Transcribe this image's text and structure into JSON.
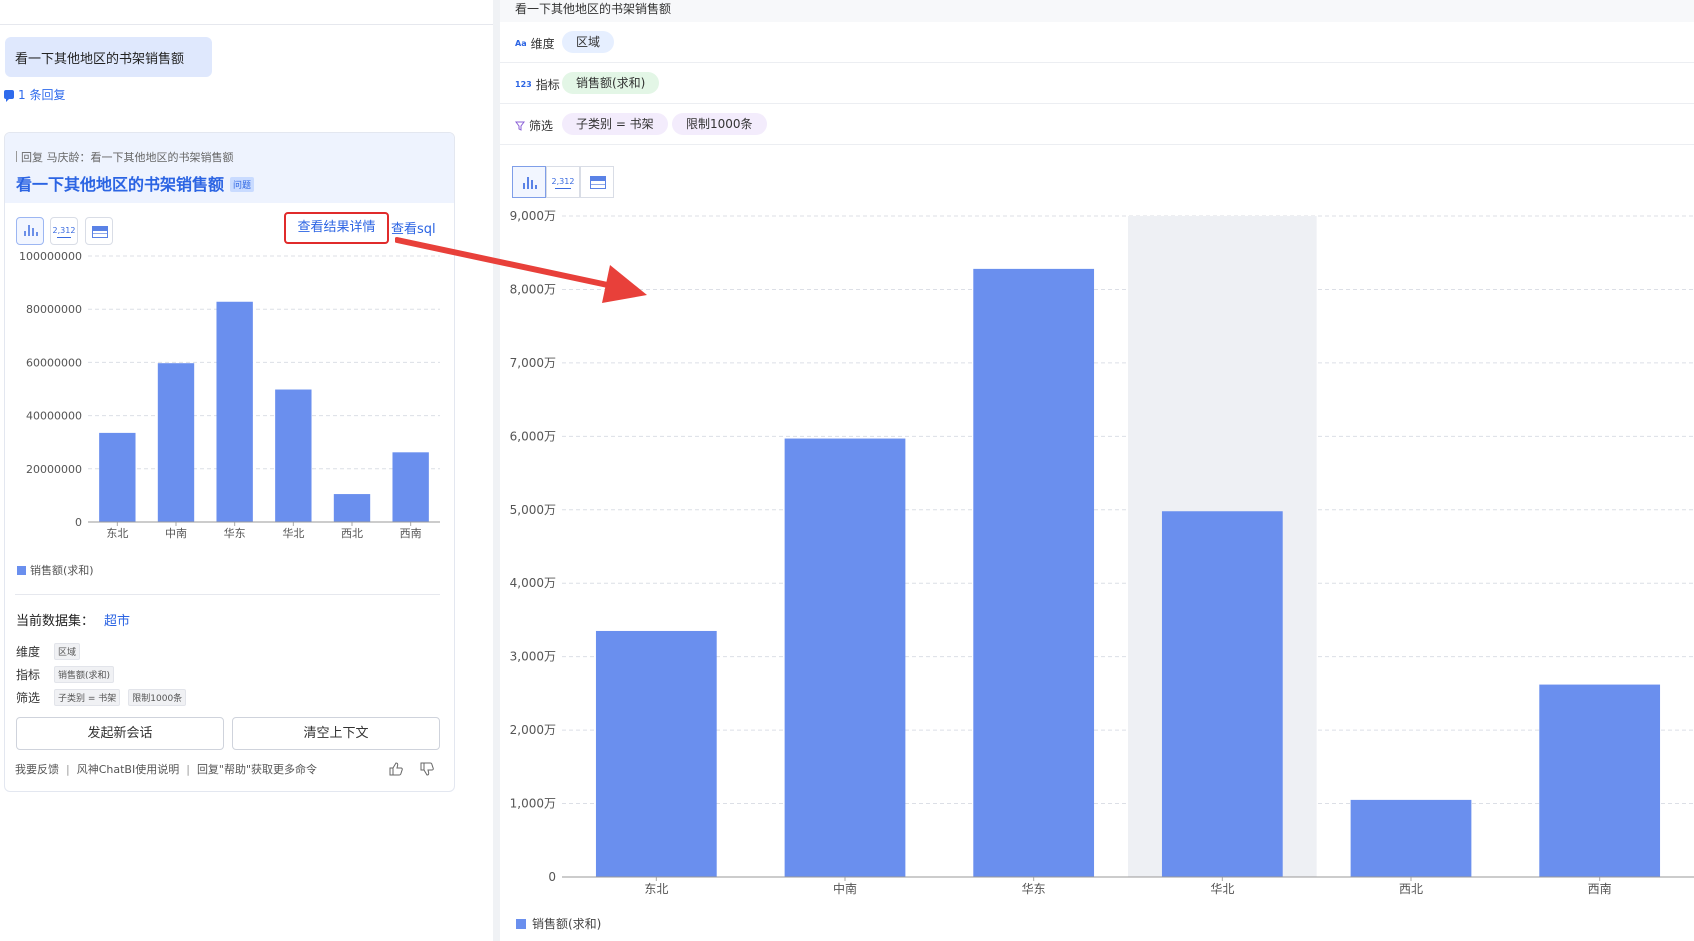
{
  "left": {
    "user_message": "看一下其他地区的书架销售额",
    "reply_count": "1 条回复",
    "card": {
      "reply_to": "回复 马庆龄：看一下其他地区的书架销售额",
      "question_title": "看一下其他地区的书架销售额",
      "question_badge": "问题",
      "view_buttons": [
        "bar-chart-icon",
        "number-card-icon",
        "table-icon"
      ],
      "view_detail_link": "查看结果详情",
      "view_sql_link": "查看sql",
      "dataset_label": "当前数据集：",
      "dataset_value": "超市",
      "dimension_label": "维度",
      "dimension_tags": [
        "区域"
      ],
      "metric_label": "指标",
      "metric_tags": [
        "销售额(求和)"
      ],
      "filter_label": "筛选",
      "filter_tags": [
        "子类别 = 书架",
        "限制1000条"
      ],
      "new_session_button": "发起新会话",
      "clear_context_button": "清空上下文",
      "footer_links": [
        "我要反馈",
        "风神ChatBI使用说明",
        "回复\"帮助\"获取更多命令"
      ]
    }
  },
  "right": {
    "title": "看一下其他地区的书架销售额",
    "dimension": {
      "label": "维度",
      "icon": "Aa",
      "tags": [
        "区域"
      ]
    },
    "metric": {
      "label": "指标",
      "icon": "123",
      "tags": [
        "销售额(求和)"
      ]
    },
    "filter": {
      "label": "筛选",
      "icon": "filter-icon",
      "tags": [
        "子类别 = 书架",
        "限制1000条"
      ]
    }
  },
  "colors": {
    "bar": "#6a8fee",
    "accent": "#2b64e3",
    "highlight_border": "#e02b2b",
    "arrow": "#e8403a"
  },
  "chart_data": [
    {
      "type": "bar",
      "categories": [
        "东北",
        "中南",
        "华东",
        "华北",
        "西北",
        "西南"
      ],
      "series": [
        {
          "name": "销售额(求和)",
          "values": [
            33500000,
            59700000,
            82800000,
            49800000,
            10500000,
            26200000
          ]
        }
      ],
      "ylim": [
        0,
        100000000
      ],
      "yticks": [
        "0",
        "20000000",
        "40000000",
        "60000000",
        "80000000",
        "100000000"
      ],
      "legend_position": "bottom-left",
      "grid": true
    },
    {
      "type": "bar",
      "categories": [
        "东北",
        "中南",
        "华东",
        "华北",
        "西北",
        "西南"
      ],
      "series": [
        {
          "name": "销售额(求和)",
          "values": [
            33500000,
            59700000,
            82800000,
            49800000,
            10500000,
            26200000
          ]
        }
      ],
      "ylim": [
        0,
        90000000
      ],
      "yticks": [
        "0",
        "1,000万",
        "2,000万",
        "3,000万",
        "4,000万",
        "5,000万",
        "6,000万",
        "7,000万",
        "8,000万",
        "9,000万"
      ],
      "hovered_category": "华北",
      "legend_position": "bottom-left",
      "grid": true
    }
  ]
}
